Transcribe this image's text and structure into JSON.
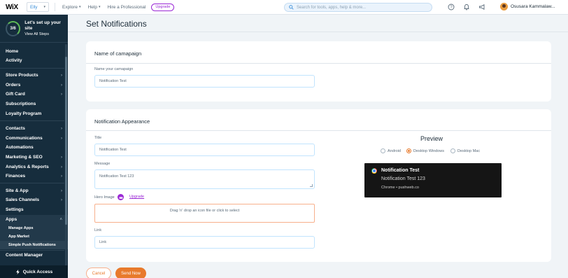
{
  "topbar": {
    "logo": "WiX",
    "site": "Elly",
    "nav": [
      "Explore",
      "Help",
      "Hire a Professional"
    ],
    "upgrade": "Upgrade",
    "search_placeholder": "Search for tools, apps, help & more...",
    "username": "Osusara Kammalaw..."
  },
  "sidebar": {
    "setup_progress": "3/6",
    "setup_title": "Let's set up your site",
    "setup_link": "View All Steps",
    "items": [
      {
        "label": "Home"
      },
      {
        "label": "Activity"
      },
      {
        "label": "Store Products"
      },
      {
        "label": "Orders"
      },
      {
        "label": "Gift Card"
      },
      {
        "label": "Subscriptions"
      },
      {
        "label": "Loyalty Program"
      },
      {
        "label": "Contacts"
      },
      {
        "label": "Communications"
      },
      {
        "label": "Automations"
      },
      {
        "label": "Marketing & SEO"
      },
      {
        "label": "Analytics & Reports"
      },
      {
        "label": "Finances"
      },
      {
        "label": "Site & App"
      },
      {
        "label": "Sales Channels"
      },
      {
        "label": "Settings"
      },
      {
        "label": "Apps"
      },
      {
        "label": "Manage Apps"
      },
      {
        "label": "App Market"
      },
      {
        "label": "Simple Push Notifications"
      },
      {
        "label": "Content Manager"
      }
    ],
    "quick_access": "Quick Access"
  },
  "page": {
    "title": "Set Notifications"
  },
  "campaign_card": {
    "title": "Name of camapaign",
    "field_label": "Name your camapaign",
    "field_value": "Notification Test"
  },
  "appearance_card": {
    "title": "Notification Appearance",
    "title_label": "Title",
    "title_value": "Notification Test",
    "message_label": "Message",
    "message_value": "Notification Test 123",
    "hero_label": "Hero Image",
    "hero_upgrade": "Upgrade",
    "drop_text": "Drag 'n' drop an icon file or click to select",
    "link_label": "Link",
    "link_placeholder": "Link"
  },
  "preview": {
    "title": "Preview",
    "options": [
      "Android",
      "Desktop Windows",
      "Desktop Mac"
    ],
    "selected": "Desktop Windows",
    "notification_title": "Notification Test",
    "notification_message": "Notification Test 123",
    "notification_source": "Chrome • pushweb.co"
  },
  "actions": {
    "cancel": "Cancel",
    "send": "Send Now"
  },
  "colors": {
    "accent": "#e87a2c",
    "upgrade": "#9a27d5",
    "sidebar_bg": "#162d3d",
    "link_blue": "#3b8fd9"
  }
}
